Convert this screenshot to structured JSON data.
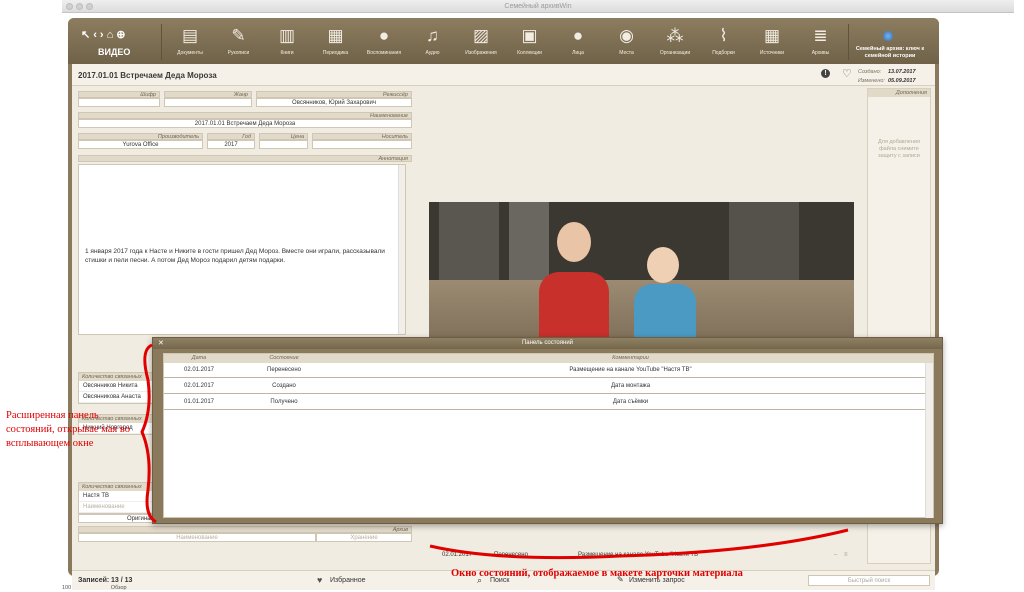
{
  "window": {
    "title": "Семейный архивWin"
  },
  "toolbar": {
    "section": "ВИДЕО",
    "items": [
      {
        "label": "Документы",
        "icon": "document-icon"
      },
      {
        "label": "Рукописи",
        "icon": "pencil-icon"
      },
      {
        "label": "Книги",
        "icon": "book-icon"
      },
      {
        "label": "Периодика",
        "icon": "calendar-icon"
      },
      {
        "label": "Воспоминания",
        "icon": "speech-bubble-icon"
      },
      {
        "label": "Аудио",
        "icon": "music-note-icon"
      },
      {
        "label": "Изображения",
        "icon": "image-icon"
      },
      {
        "label": "Коллекции",
        "icon": "box-icon"
      },
      {
        "label": "Лица",
        "icon": "person-icon"
      },
      {
        "label": "Места",
        "icon": "globe-icon"
      },
      {
        "label": "Организации",
        "icon": "group-icon"
      },
      {
        "label": "Подборки",
        "icon": "paperclip-icon"
      },
      {
        "label": "Источники",
        "icon": "grid-icon"
      },
      {
        "label": "Архивы",
        "icon": "database-icon"
      }
    ],
    "right_title": "Семейный архив: ключ к семейной истории"
  },
  "record": {
    "title": "2017.01.01 Встречаем Деда Мороза",
    "created_label": "Создано:",
    "created": "13.07.2017",
    "modified_label": "Изменено:",
    "modified": "05.09.2017"
  },
  "fields": {
    "cipher_label": "Шифр",
    "cipher": "",
    "genre_label": "Жанр",
    "genre": "",
    "director_label": "Режиссёр",
    "director": "Овсянников, Юрий Захарович",
    "name_label": "Наименование",
    "name": "2017.01.01 Встречаем Деда Мороза",
    "producer_label": "Производитель",
    "producer": "Yurova Office",
    "year_label": "Год",
    "year": "2017",
    "price_label": "Цена",
    "price": "",
    "carrier_label": "Носитель",
    "carrier": "",
    "annotation_label": "Аннотация",
    "annotation": "1 января 2017 года к Насте и Никите в гости пришел Дед Мороз. Вместе они играли, рассказывали стишки и пели песни. А потом Дед Мороз подарил детям подарки."
  },
  "groups": [
    {
      "header": "Количество связанных",
      "rows": [
        "Овсянников Никита",
        "Овсянникова Анаста"
      ]
    },
    {
      "header": "Количество связанных",
      "rows": [
        "Нижний Новгород"
      ]
    },
    {
      "header": "Количество связанных",
      "rows": [
        "Настя ТВ",
        "Наименование"
      ]
    }
  ],
  "left_bottom": {
    "value": "Оригинал",
    "archive_label": "Архив",
    "name_placeholder": "Наименование",
    "storage_placeholder": "Хранение"
  },
  "right_panel": {
    "header": "Дополнения",
    "hint": "Для добавления файла снимите защиту с записи"
  },
  "popup": {
    "title": "Панель состояний",
    "columns": [
      "Дата",
      "Состояние",
      "Комментарии"
    ],
    "rows": [
      {
        "date": "02.01.2017",
        "state": "Перенесено",
        "comment": "Размещение на канале YouTube \"Настя ТВ\""
      },
      {
        "date": "02.01.2017",
        "state": "Создано",
        "comment": "Дата монтажа"
      },
      {
        "date": "01.01.2017",
        "state": "Получено",
        "comment": "Дата съёмки"
      }
    ]
  },
  "state_bar": {
    "date": "02.01.2017",
    "state": "Перенесено",
    "comment": "Размещение на канале YouTube \"Настя ТВ\""
  },
  "bottom": {
    "records_label": "Записей:",
    "records": "13 / 13",
    "favorites": "Избранное",
    "search": "Поиск",
    "clear_query": "Изменить запрос",
    "quick_search": "Быстрый поиск"
  },
  "annotations": {
    "left": "Расширенная панель состояний, открывае мая во всплывающем окне",
    "bottom": "Окно состояний, отображаемое в макете карточки материала"
  },
  "status_strip": {
    "zoom": "100",
    "mode": "Обзор"
  },
  "colors": {
    "frame": "#8a7a5b",
    "panel": "#f1ece1",
    "annotation": "#e00000"
  }
}
